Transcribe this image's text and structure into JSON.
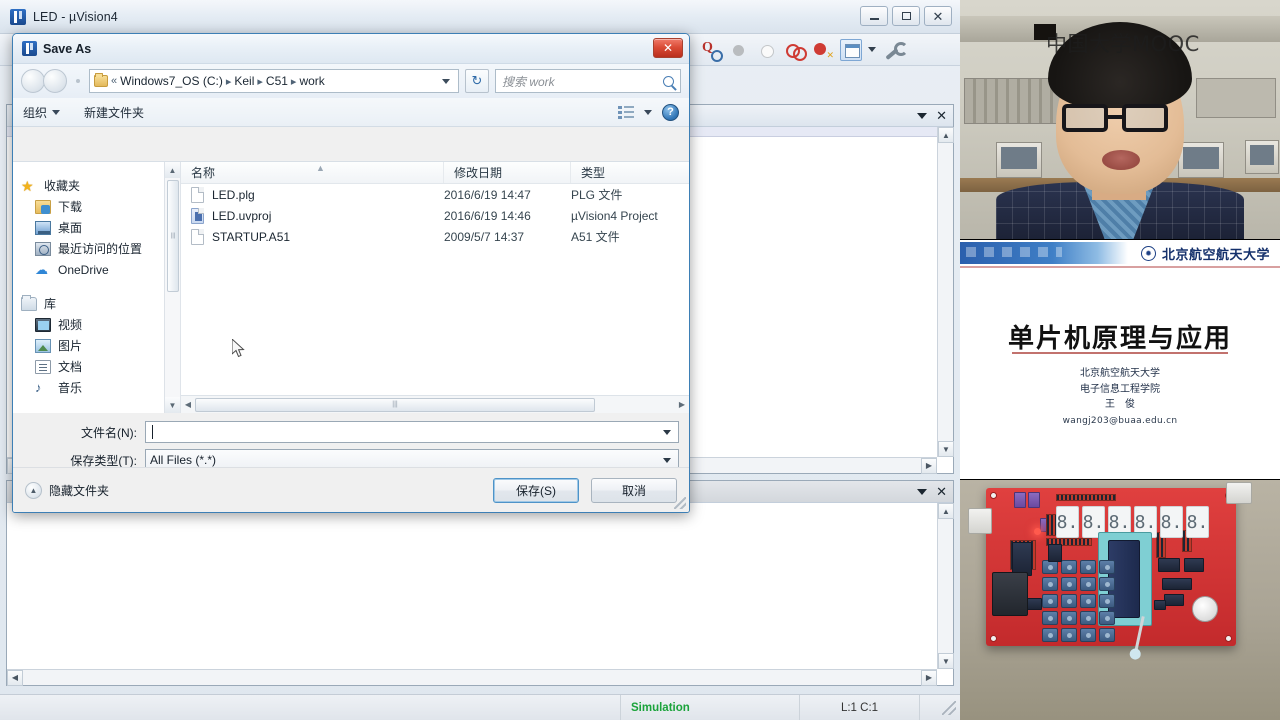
{
  "uvision": {
    "title": "LED  -  µVision4",
    "window_buttons": {
      "minimize": "—",
      "maximize": "▢",
      "close": "✕"
    },
    "toolbar_icons": [
      "magnify-icon",
      "breakpoint-disabled-icon",
      "breakpoint-empty-icon",
      "breakpoints-icon",
      "kill-breakpoints-icon",
      "window-list-icon",
      "configure-icon"
    ],
    "panel_caption_buttons": {
      "menu": "▾",
      "close": "✕"
    },
    "statusbar": {
      "simulation": "Simulation",
      "position": "L:1 C:1"
    }
  },
  "save_dialog": {
    "title": "Save As",
    "close_label": "✕",
    "breadcrumb": {
      "chevron_back": "«",
      "segments": [
        "Windows7_OS (C:)",
        "Keil",
        "C51",
        "work"
      ],
      "separator": "▸"
    },
    "refresh_label": "↻",
    "search": {
      "placeholder": "搜索 work"
    },
    "commandbar": {
      "organize": "组织",
      "new_folder": "新建文件夹",
      "help": "?"
    },
    "sidebar": {
      "groups": [
        {
          "root": {
            "label": "收藏夹",
            "icon": "star-icon"
          },
          "items": [
            {
              "label": "下载",
              "icon": "downloads-icon"
            },
            {
              "label": "桌面",
              "icon": "desktop-icon"
            },
            {
              "label": "最近访问的位置",
              "icon": "recent-places-icon"
            },
            {
              "label": "OneDrive",
              "icon": "onedrive-icon"
            }
          ]
        },
        {
          "root": {
            "label": "库",
            "icon": "libraries-icon"
          },
          "items": [
            {
              "label": "视频",
              "icon": "videos-icon"
            },
            {
              "label": "图片",
              "icon": "pictures-icon"
            },
            {
              "label": "文档",
              "icon": "documents-icon"
            },
            {
              "label": "音乐",
              "icon": "music-icon"
            }
          ]
        }
      ]
    },
    "filelist": {
      "columns": [
        "名称",
        "修改日期",
        "类型"
      ],
      "rows": [
        {
          "name": "LED.plg",
          "date": "2016/6/19 14:47",
          "type": "PLG 文件",
          "icon": "generic-file-icon"
        },
        {
          "name": "LED.uvproj",
          "date": "2016/6/19 14:46",
          "type": "µVision4 Project",
          "icon": "uvision-project-icon"
        },
        {
          "name": "STARTUP.A51",
          "date": "2009/5/7 14:37",
          "type": "A51 文件",
          "icon": "generic-file-icon"
        }
      ]
    },
    "form": {
      "filename_label": "文件名(N):",
      "filename_value": "",
      "filetype_label": "保存类型(T):",
      "filetype_value": "All Files (*.*)"
    },
    "footer": {
      "hide_folders": "隐藏文件夹",
      "hide_folders_caret": "▲",
      "save": "保存(S)",
      "cancel": "取消"
    }
  },
  "video": {
    "webcam": {
      "watermark": "中国大学MOOC"
    },
    "slide": {
      "university": "北京航空航天大学",
      "title": "单片机原理与应用",
      "affiliation_line1": "北京航空航天大学",
      "affiliation_line2": "电子信息工程学院",
      "author": "王　俊",
      "email": "wangj203@buaa.edu.cn"
    },
    "board": {
      "display_digits": [
        "8.",
        "8.",
        "8.",
        "8.",
        "8.",
        "8."
      ]
    }
  }
}
